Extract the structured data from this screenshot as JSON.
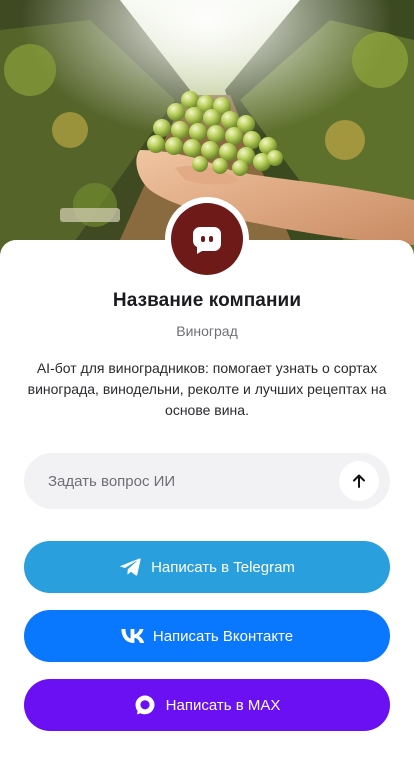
{
  "company": {
    "name": "Название компании",
    "category": "Виноград",
    "description": "AI-бот для виноградников: помогает узнать о сортах винограда, винодельни, реколте и лучших рецептах на основе вина."
  },
  "ask_ai": {
    "placeholder": "Задать вопрос ИИ",
    "value": "",
    "send_icon": "arrow-up-icon"
  },
  "buttons": {
    "telegram": {
      "label": "Написать в Telegram",
      "icon": "telegram-icon",
      "color": "#2a9fde"
    },
    "vk": {
      "label": "Написать Вконтакте",
      "icon": "vk-icon",
      "color": "#0a77ff"
    },
    "max": {
      "label": "Написать в MAX",
      "icon": "max-icon",
      "color": "#6a10f2"
    }
  },
  "colors": {
    "avatar_background": "#6e1a19",
    "input_background": "#f2f2f4"
  },
  "hero": {
    "image": "vineyard-grapes-in-hand"
  }
}
